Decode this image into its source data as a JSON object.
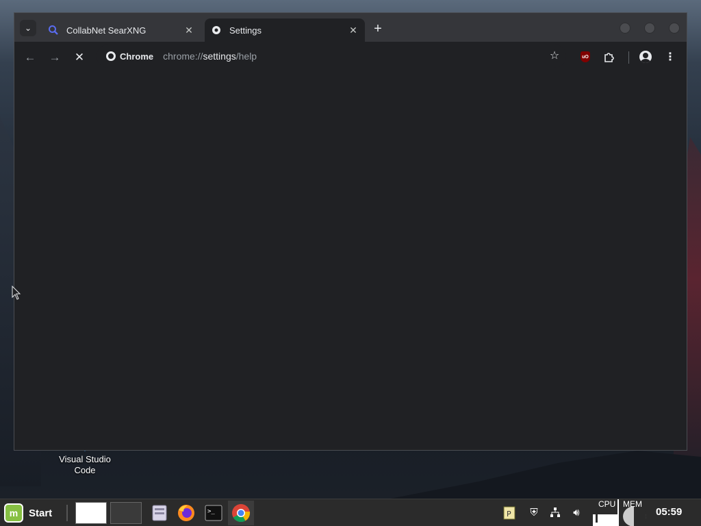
{
  "window": {
    "tabs": [
      {
        "title": "CollabNet SearXNG",
        "favicon": "search-icon",
        "active": false
      },
      {
        "title": "Settings",
        "favicon": "gear-icon",
        "active": true
      }
    ]
  },
  "toolbar": {
    "chip_label": "Chrome",
    "url_scheme": "chrome://",
    "url_host": "settings",
    "url_path": "/help"
  },
  "desktop": {
    "icon_label": "Visual Studio Code"
  },
  "taskbar": {
    "start_label": "Start",
    "cpu_label": "CPU",
    "mem_label": "MEM",
    "clock": "05:59"
  },
  "colors": {
    "tab_active": "#202124",
    "tabstrip": "#35363a",
    "mint_green": "#87c043"
  }
}
